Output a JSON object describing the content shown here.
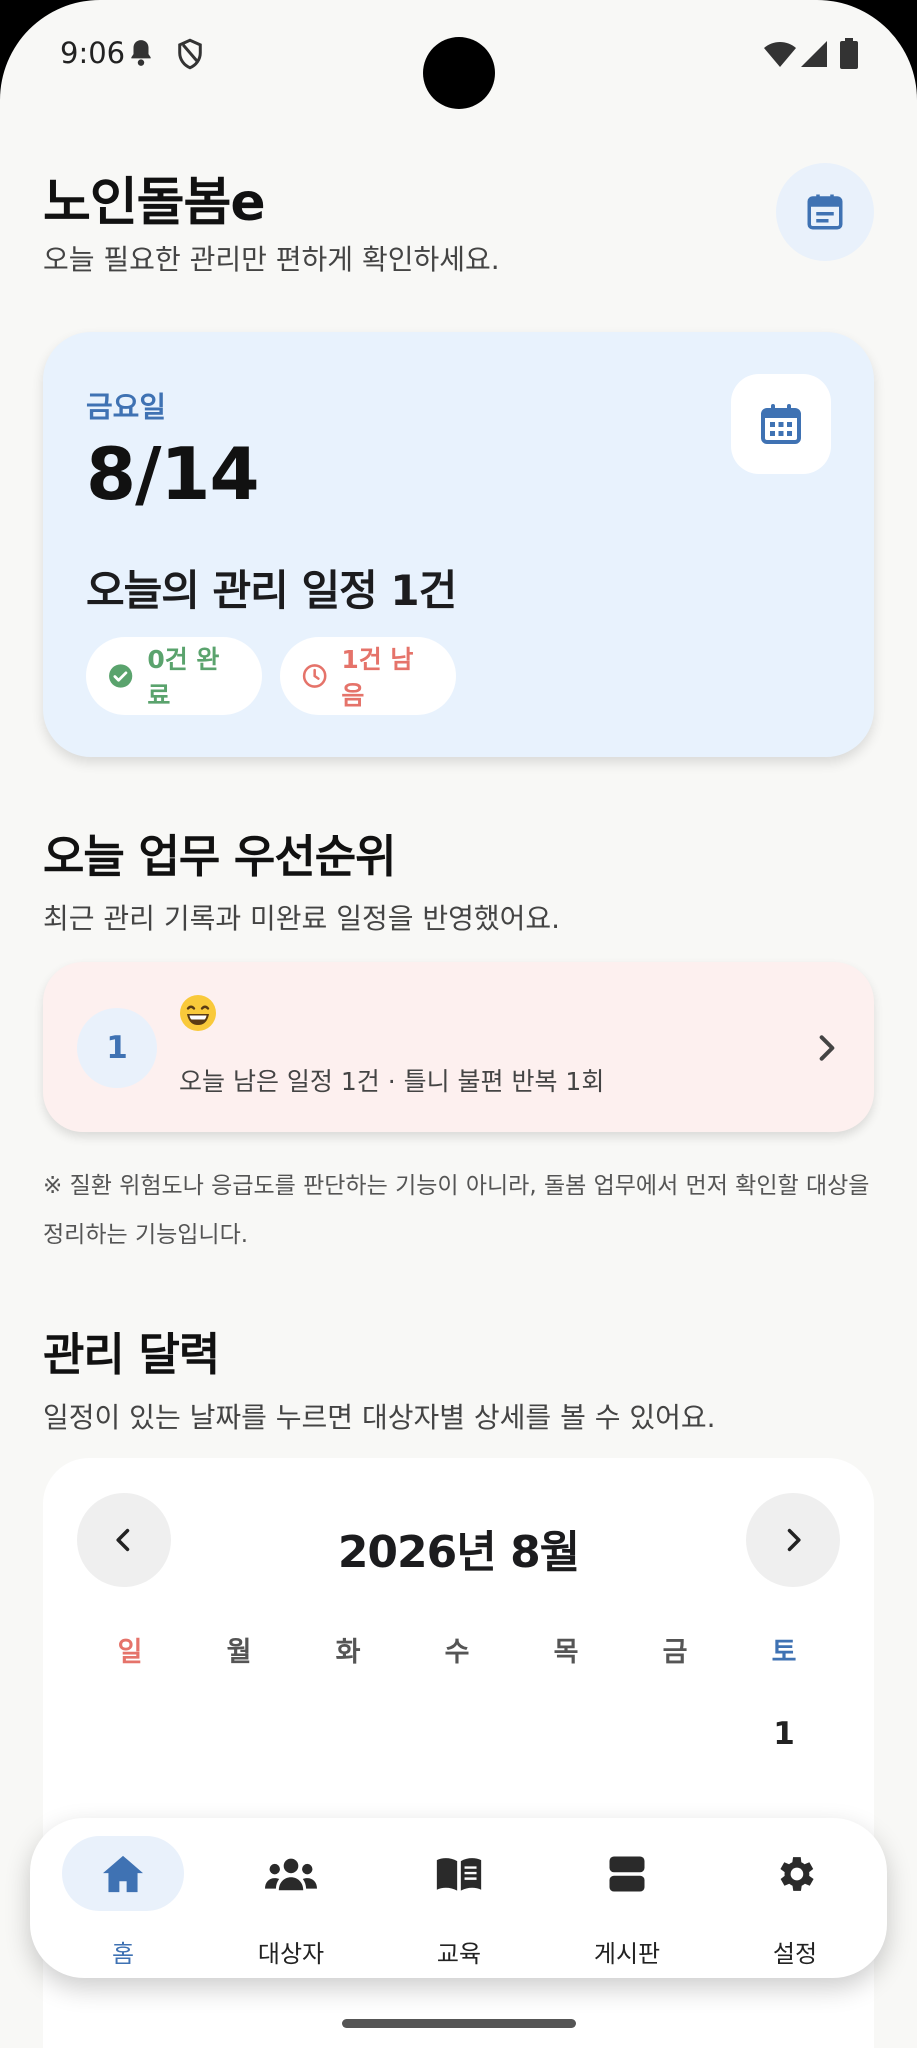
{
  "status_bar": {
    "time": "9:06",
    "left_icons": [
      "bell-icon",
      "shield-icon"
    ],
    "right_icons": [
      "wifi-icon",
      "signal-icon",
      "battery-icon"
    ]
  },
  "header": {
    "title": "노인돌봄e",
    "subtitle": "오늘 필요한 관리만 편하게 확인하세요.",
    "action_icon": "calendar-icon"
  },
  "today_card": {
    "weekday": "금요일",
    "date": "8/14",
    "schedule_summary": "오늘의 관리 일정 1건",
    "completed_label": "0건 완료",
    "remaining_label": "1건 남음",
    "icon": "calendar-icon"
  },
  "priority_section": {
    "title": "오늘 업무 우선순위",
    "subtitle": "최근 관리 기록과 미완료 일정을 반영했어요.",
    "items": [
      {
        "rank": "1",
        "emoji": "😄",
        "detail": "오늘 남은 일정 1건 · 틀니 불편 반복 1회"
      }
    ],
    "notice": "※ 질환 위험도나 응급도를 판단하는 기능이 아니라, 돌봄 업무에서 먼저 확인할 대상을 정리하는 기능입니다."
  },
  "calendar_section": {
    "title": "관리 달력",
    "subtitle": "일정이 있는 날짜를 누르면 대상자별 상세를 볼 수 있어요.",
    "month_label": "2026년 8월",
    "weekdays": [
      "일",
      "월",
      "화",
      "수",
      "목",
      "금",
      "토"
    ],
    "first_row_days": [
      "",
      "",
      "",
      "",
      "",
      "",
      "1"
    ]
  },
  "bottom_nav": {
    "items": [
      {
        "label": "홈",
        "icon": "home-icon",
        "active": true
      },
      {
        "label": "대상자",
        "icon": "users-icon",
        "active": false
      },
      {
        "label": "교육",
        "icon": "book-icon",
        "active": false
      },
      {
        "label": "게시판",
        "icon": "board-icon",
        "active": false
      },
      {
        "label": "설정",
        "icon": "gear-icon",
        "active": false
      }
    ]
  },
  "colors": {
    "accent_blue": "#3f72b3",
    "success_green": "#5aa36d",
    "warning_red": "#e5736a",
    "today_card_bg": "#e8f2fd",
    "priority_card_bg": "#fdf0ef"
  }
}
